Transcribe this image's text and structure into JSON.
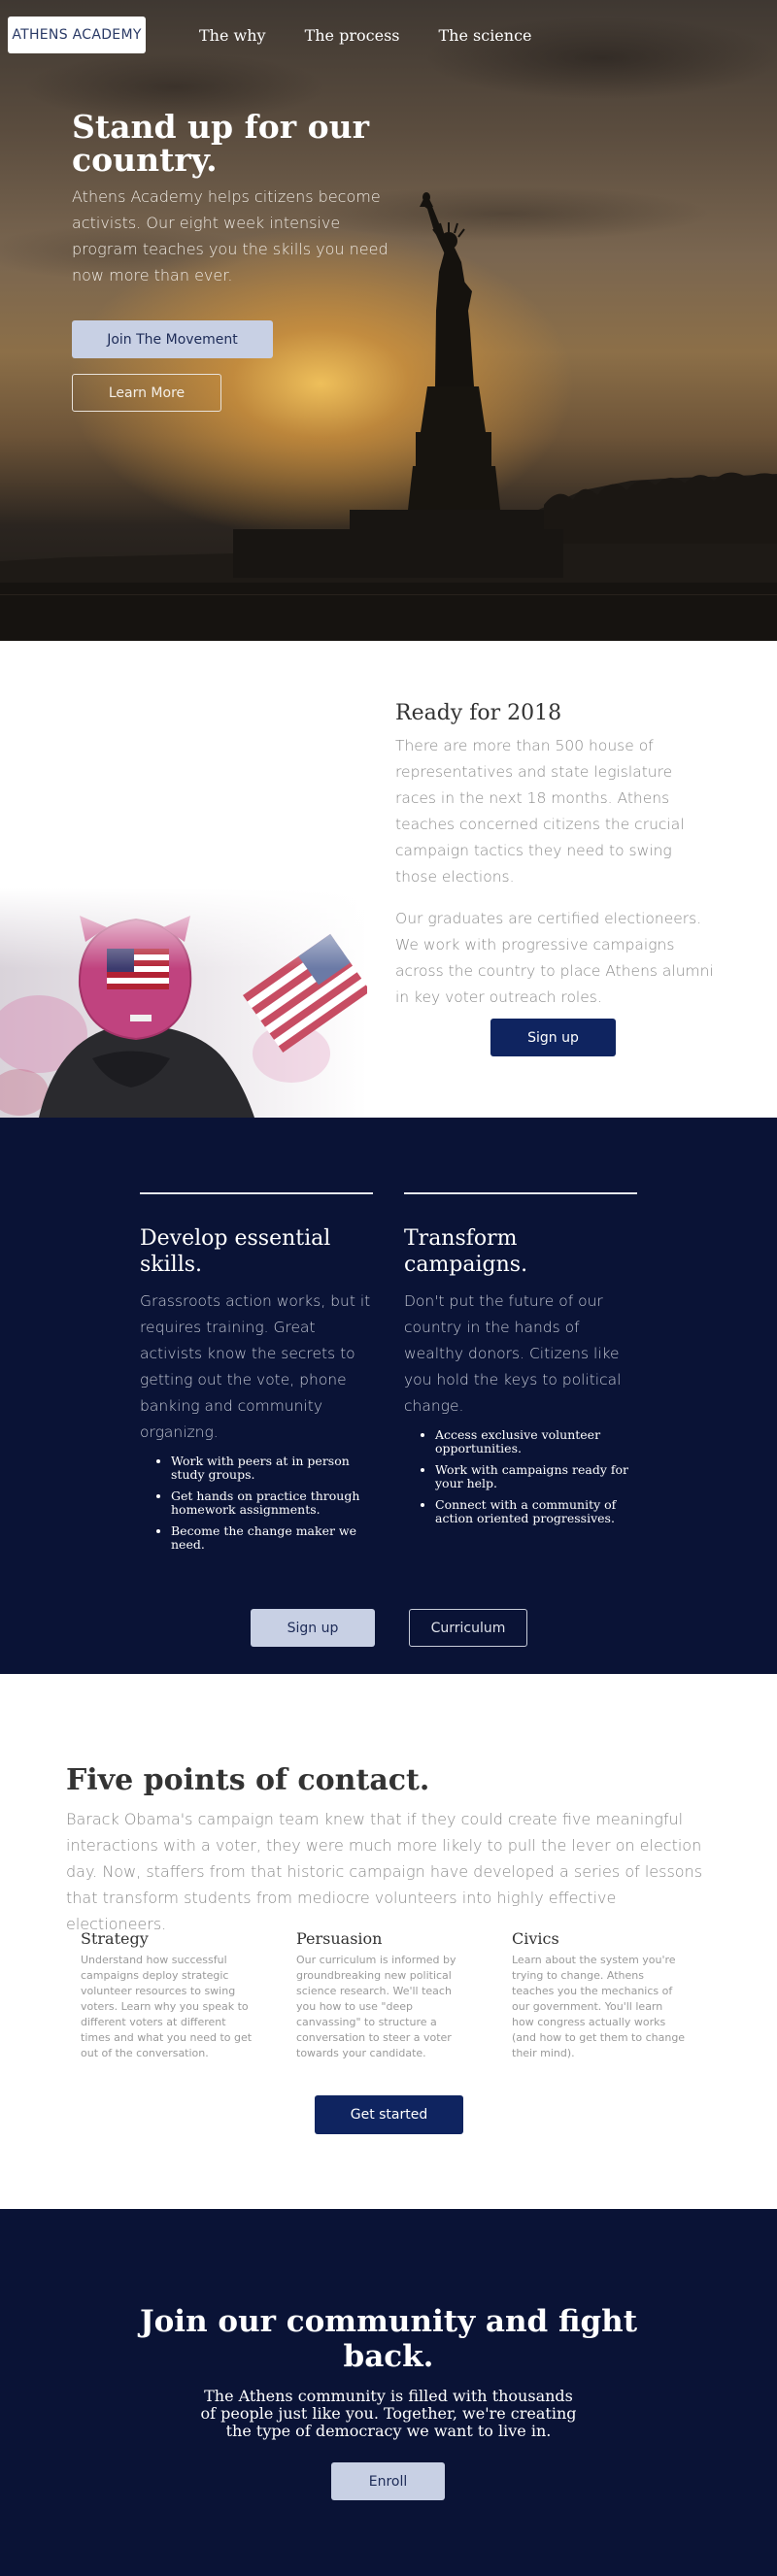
{
  "nav": {
    "logo": "ATHENS ACADEMY",
    "links": [
      "The why",
      "The process",
      "The science"
    ]
  },
  "hero": {
    "title": "Stand up for our country.",
    "subtitle": "Athens Academy helps citizens become activists. Our eight week intensive program teaches you the skills you need now more than ever.",
    "primary_button": "Join The Movement",
    "secondary_button": "Learn More"
  },
  "ready": {
    "title": "Ready for 2018",
    "paragraph1": "There are more than 500 house of representatives and state legislature races in the next 18 months. Athens teaches concerned citizens the crucial campaign tactics they need to swing those elections.",
    "paragraph2": "Our graduates are certified electioneers. We work with progressive campaigns across the country to place Athens alumni in key voter outreach roles.",
    "button": "Sign up"
  },
  "features": {
    "left": {
      "title": "Develop essential skills.",
      "paragraph": "Grassroots action works, but it requires training. Great activists know the secrets to getting out the vote, phone banking and community organizng.",
      "items": [
        "Work with peers at in person study groups.",
        "Get hands on practice through homework assignments.",
        "Become the change maker we need."
      ]
    },
    "right": {
      "title": "Transform campaigns.",
      "paragraph": "Don't put the future of our country in the hands of wealthy donors. Citizens like you hold the keys to political change.",
      "items": [
        "Access exclusive volunteer opportunities.",
        "Work with campaigns ready for your help.",
        "Connect with a community of action oriented progressives."
      ]
    },
    "signup_button": "Sign up",
    "curriculum_button": "Curriculum"
  },
  "points": {
    "title": "Five points of contact.",
    "intro": "Barack Obama's campaign team knew that if they could create five meaningful interactions with a voter, they were much more likely to pull the lever on election day. Now, staffers from that historic campaign have developed a series of lessons that transform students from mediocre volunteers into highly effective electioneers.",
    "columns": [
      {
        "title": "Strategy",
        "text": "Understand how successful campaigns deploy strategic volunteer resources to swing voters. Learn why you speak to different voters at different times and what you need to get out of the conversation."
      },
      {
        "title": "Persuasion",
        "text": "Our curriculum is informed by groundbreaking new political science research. We'll teach you how to use \"deep canvassing\" to structure a conversation to steer a voter towards your candidate."
      },
      {
        "title": "Civics",
        "text": "Learn about the system you're trying to change. Athens teaches you the mechanics of our government. You'll learn how congress actually works (and how to get them to change their mind)."
      }
    ],
    "button": "Get started"
  },
  "join": {
    "title": "Join our community and fight back.",
    "paragraph": "The Athens community is filled with thousands of people just like you. Together, we're creating the type of democracy we want to live in.",
    "button": "Enroll"
  },
  "colors": {
    "navy": "#0a1336",
    "button_navy": "#0f2460",
    "button_light": "#c8d0e4"
  }
}
